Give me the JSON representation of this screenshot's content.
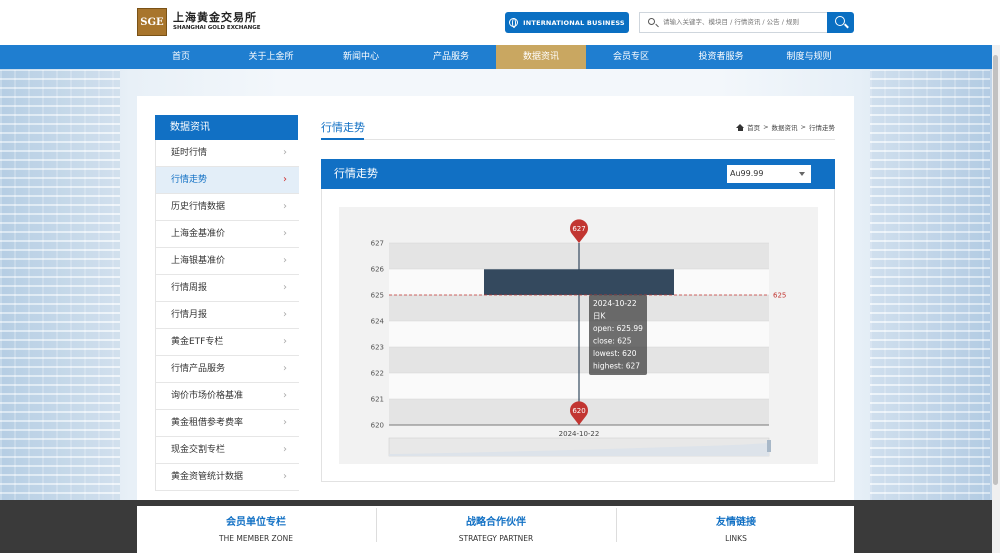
{
  "header": {
    "logo_text_cn": "上海黄金交易所",
    "logo_text_en": "SHANGHAI GOLD EXCHANGE",
    "logo_mark": "SGE",
    "intl_button": "INTERNATIONAL BUSINESS",
    "search_placeholder": "请输入关键字、模块目 / 行情资讯 / 公告 / 规则"
  },
  "nav": {
    "items": [
      {
        "label": "首页"
      },
      {
        "label": "关于上金所"
      },
      {
        "label": "新闻中心"
      },
      {
        "label": "产品服务"
      },
      {
        "label": "数据资讯"
      },
      {
        "label": "会员专区"
      },
      {
        "label": "投资者服务"
      },
      {
        "label": "制度与规则"
      }
    ],
    "active_index": 4
  },
  "sidebar": {
    "title": "数据资讯",
    "items": [
      {
        "label": "延时行情"
      },
      {
        "label": "行情走势"
      },
      {
        "label": "历史行情数据"
      },
      {
        "label": "上海金基准价"
      },
      {
        "label": "上海银基准价"
      },
      {
        "label": "行情周报"
      },
      {
        "label": "行情月报"
      },
      {
        "label": "黄金ETF专栏"
      },
      {
        "label": "行情产品服务"
      },
      {
        "label": "询价市场价格基准"
      },
      {
        "label": "黄金租借参考费率"
      },
      {
        "label": "现金交割专栏"
      },
      {
        "label": "黄金资管统计数据"
      }
    ],
    "active_index": 1
  },
  "main": {
    "title": "行情走势",
    "breadcrumb": [
      "首页",
      ">",
      "数据资讯",
      ">",
      "行情走势"
    ],
    "chart_title": "行情走势",
    "instrument": "Au99.99"
  },
  "chart_data": {
    "type": "candlestick",
    "categories": [
      "2024-10-22"
    ],
    "series": [
      {
        "date": "2024-10-22",
        "open": 625.99,
        "close": 625,
        "lowest": 620,
        "highest": 627
      }
    ],
    "ylim": [
      620,
      627
    ],
    "yticks": [
      620,
      621,
      622,
      623,
      624,
      625,
      626,
      627
    ],
    "markline_value": 625,
    "markpoint_high": "627",
    "markpoint_low": "620",
    "grid": true,
    "tooltip": {
      "date": "2024-10-22",
      "period": "日K",
      "lines": [
        "open: 625.99",
        "close: 625",
        "lowest: 620",
        "highest: 627"
      ]
    },
    "colors": {
      "body": "#34495e",
      "markline": "#c23531",
      "markpoint": "#c23531"
    }
  },
  "footer": {
    "cols": [
      {
        "cn": "会员单位专栏",
        "en": "THE MEMBER ZONE"
      },
      {
        "cn": "战略合作伙伴",
        "en": "STRATEGY PARTNER"
      },
      {
        "cn": "友情链接",
        "en": "LINKS"
      }
    ]
  }
}
